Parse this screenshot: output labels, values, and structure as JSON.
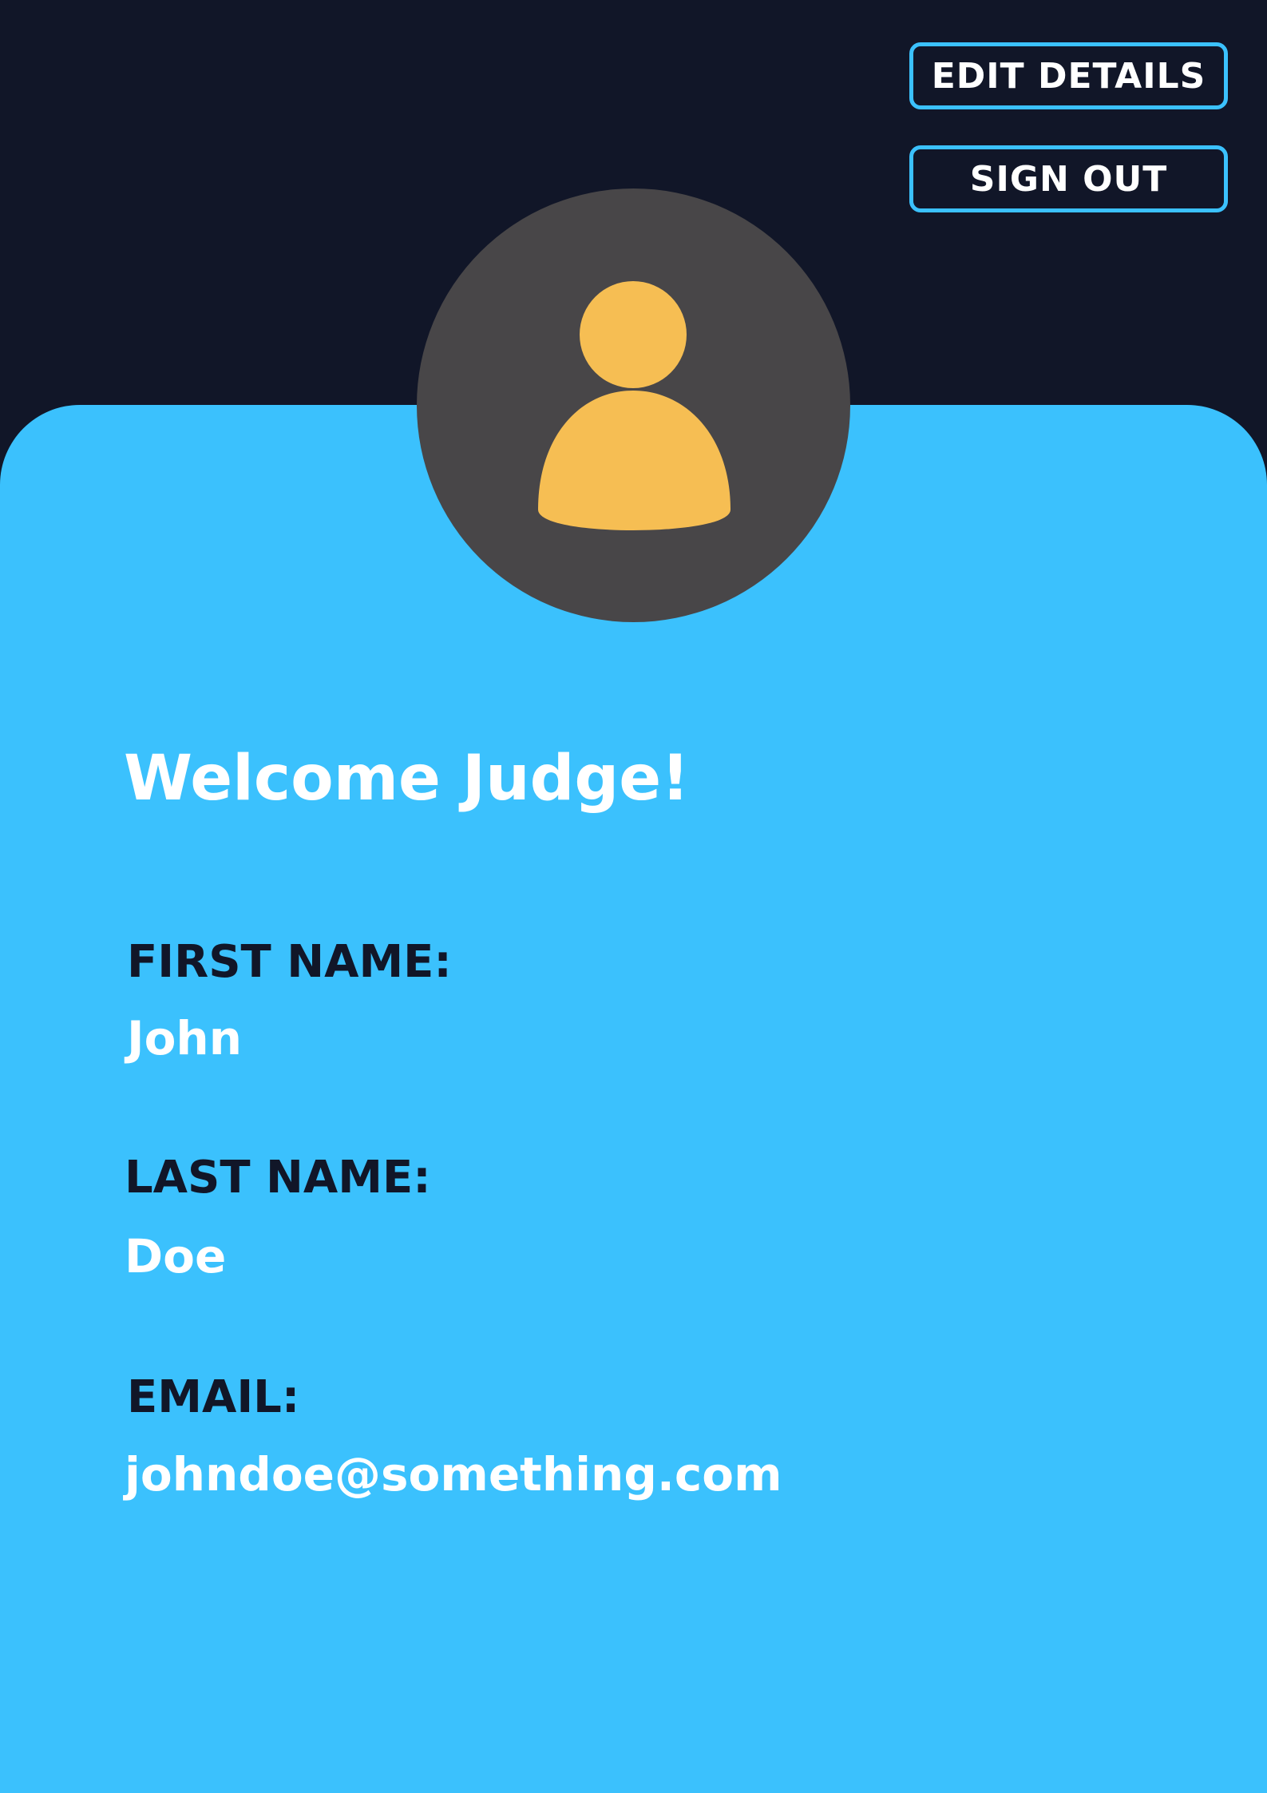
{
  "header": {
    "edit_label": "EDIT DETAILS",
    "signout_label": "SIGN OUT"
  },
  "avatar": {
    "icon": "user-icon",
    "icon_color": "#f6be53",
    "background_color": "#484648"
  },
  "profile": {
    "welcome": "Welcome Judge!",
    "fields": [
      {
        "label": "FIRST NAME:",
        "value": "John"
      },
      {
        "label": "LAST NAME:",
        "value": "Doe"
      },
      {
        "label": "EMAIL:",
        "value": "johndoe@something.com"
      }
    ]
  },
  "colors": {
    "header_bg": "#111628",
    "panel_bg": "#3bc1fd",
    "button_border": "#3bc1fd",
    "label_text": "#111628",
    "value_text": "#ffffff"
  }
}
